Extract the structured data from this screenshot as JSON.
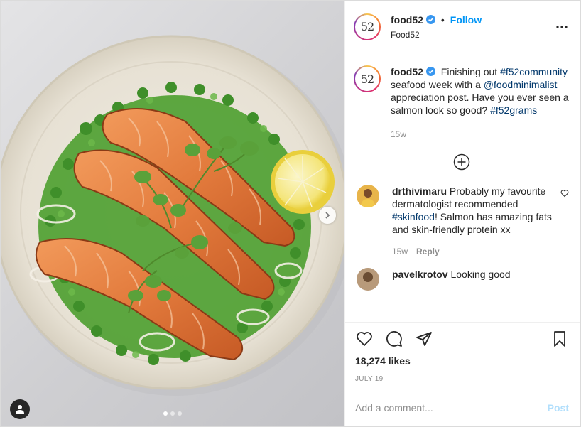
{
  "post": {
    "account": {
      "username": "food52",
      "display_name": "Food52",
      "follow_label": "Follow",
      "bullet": "•",
      "logo_text": "52"
    },
    "caption": {
      "username": "food52",
      "text_1": "Finishing out",
      "hashtag_1": "#f52community",
      "text_2": "seafood week with a",
      "mention": "@foodminimalist",
      "text_3": "appreciation post. Have you ever seen a salmon look so good?",
      "hashtag_2": "#f52grams",
      "time": "15w"
    },
    "comments": [
      {
        "username": "drthivimaru",
        "text_1": "Probably my favourite dermatologist recommended",
        "hashtag": "#skinfood",
        "text_2": "! Salmon has amazing fats and skin-friendly protein xx",
        "time": "15w",
        "reply_label": "Reply"
      },
      {
        "username": "pavelkrotov",
        "text": "Looking good"
      }
    ],
    "likes": "18,274 likes",
    "date": "JULY 19",
    "add_comment_placeholder": "Add a comment...",
    "post_label": "Post",
    "carousel": {
      "count": 3,
      "active_index": 0
    }
  },
  "icons": {
    "more": "more-options-icon",
    "verified": "verified-badge-icon",
    "load_more": "load-more-comments-icon",
    "like": "heart-icon",
    "comment": "comment-icon",
    "share": "share-icon",
    "save": "bookmark-icon",
    "tag": "user-tag-icon",
    "next": "chevron-right-icon"
  },
  "colors": {
    "link": "#00376b",
    "follow": "#0095f6",
    "post_disabled": "#b2dffc",
    "verified": "#3897f0"
  }
}
